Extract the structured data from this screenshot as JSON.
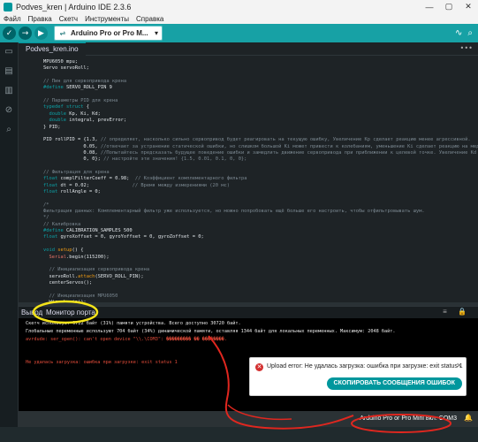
{
  "window": {
    "title": "Podves_kren | Arduino IDE 2.3.6",
    "controls": [
      "—",
      "▢",
      "✕"
    ]
  },
  "menu": [
    "Файл",
    "Правка",
    "Скетч",
    "Инструменты",
    "Справка"
  ],
  "toolbar": {
    "board": "Arduino Pro or Pro M..."
  },
  "tab": {
    "name": "Podves_kren.ino",
    "more": "•••"
  },
  "code": [
    {
      "n": "",
      "t": [
        [
          "MPU6050 mpu;",
          ""
        ]
      ]
    },
    {
      "n": "",
      "t": [
        [
          "Servo servoRoll;",
          ""
        ]
      ]
    },
    {
      "n": "",
      "t": [
        [
          "",
          ""
        ]
      ]
    },
    {
      "n": "",
      "t": [
        [
          "// Пин для сервопривода крена",
          "c"
        ]
      ]
    },
    {
      "n": "",
      "t": [
        [
          "#define ",
          "k"
        ],
        [
          "SERVO_ROLL_PIN 9",
          ""
        ]
      ]
    },
    {
      "n": "",
      "t": [
        [
          "",
          ""
        ]
      ]
    },
    {
      "n": "",
      "t": [
        [
          "// Параметры PID для крена",
          "c"
        ]
      ]
    },
    {
      "n": "",
      "t": [
        [
          "typedef struct ",
          "k"
        ],
        [
          "{",
          ""
        ]
      ]
    },
    {
      "n": "",
      "t": [
        [
          "  double ",
          "k"
        ],
        [
          "Kp, Ki, Kd;",
          ""
        ]
      ]
    },
    {
      "n": "",
      "t": [
        [
          "  double ",
          "k"
        ],
        [
          "integral, prevError;",
          ""
        ]
      ]
    },
    {
      "n": "",
      "t": [
        [
          "} PID;",
          ""
        ]
      ]
    },
    {
      "n": "",
      "t": [
        [
          "",
          ""
        ]
      ]
    },
    {
      "n": "",
      "t": [
        [
          "PID rollPID = {1.3, ",
          ""
        ],
        [
          "// определяет, насколько сильно сервопривод будет реагировать на текущую ошибку, Увеличение Kp сделает реакцию менее агрессивной.",
          "c"
        ]
      ]
    },
    {
      "n": "",
      "t": [
        [
          "              0.05, ",
          ""
        ],
        [
          "//отвечает за устранение статической ошибки, но слишком большой Ki может привести к колебаниям, уменьшение Ki сделает реакцию на медленные измене",
          "c"
        ]
      ]
    },
    {
      "n": "",
      "t": [
        [
          "              0.08, ",
          ""
        ],
        [
          "//Попытайтесь предсказать будущее поведение ошибки и замедлить движение сервопривода при приближении к целевой точке. Увеличение Kd поможет сгладить",
          "c"
        ]
      ]
    },
    {
      "n": "",
      "t": [
        [
          "              0, 0}; ",
          ""
        ],
        [
          "// настройте эти значения! {1.5, 0.01, 0.1, 0, 0};",
          "c"
        ]
      ]
    },
    {
      "n": "",
      "t": [
        [
          "",
          ""
        ]
      ]
    },
    {
      "n": "",
      "t": [
        [
          "// Фильтрация для крена",
          "c"
        ]
      ]
    },
    {
      "n": "",
      "t": [
        [
          "float ",
          "k"
        ],
        [
          "complFilterCoeff = 0.98;  ",
          ""
        ],
        [
          "// Коэффициент комплементарного фильтра",
          "c"
        ]
      ]
    },
    {
      "n": "",
      "t": [
        [
          "float ",
          "k"
        ],
        [
          "dt = 0.02;               ",
          ""
        ],
        [
          "// Время между измерениями (20 мс)",
          "c"
        ]
      ]
    },
    {
      "n": "",
      "t": [
        [
          "float ",
          "k"
        ],
        [
          "rollAngle = 0;",
          ""
        ]
      ]
    },
    {
      "n": "",
      "t": [
        [
          "",
          ""
        ]
      ]
    },
    {
      "n": "",
      "t": [
        [
          "/*",
          "c"
        ]
      ]
    },
    {
      "n": "",
      "t": [
        [
          "Фильтрация данных: Комплементарный фильтр уже используется, но можно попробовать ещё больше его настроить, чтобы отфильтровывать шум.",
          "c"
        ]
      ]
    },
    {
      "n": "",
      "t": [
        [
          "*/",
          "c"
        ]
      ]
    },
    {
      "n": "",
      "t": [
        [
          "// Калибровка",
          "c"
        ]
      ]
    },
    {
      "n": "",
      "t": [
        [
          "#define ",
          "k"
        ],
        [
          "CALIBRATION_SAMPLES 500",
          ""
        ]
      ]
    },
    {
      "n": "",
      "t": [
        [
          "float ",
          "k"
        ],
        [
          "gyroXoffset = 0, gyroYoffset = 0, gyroZoffset = 0;",
          ""
        ]
      ]
    },
    {
      "n": "",
      "t": [
        [
          "",
          ""
        ]
      ]
    },
    {
      "n": "",
      "t": [
        [
          "void ",
          "k"
        ],
        [
          "setup",
          "f"
        ],
        [
          "() {",
          ""
        ]
      ]
    },
    {
      "n": "",
      "t": [
        [
          "  Serial",
          "t"
        ],
        [
          ".begin(115200);",
          ""
        ]
      ]
    },
    {
      "n": "",
      "t": [
        [
          "",
          ""
        ]
      ]
    },
    {
      "n": "",
      "t": [
        [
          "  // Инициализация сервопривода крена",
          "c"
        ]
      ]
    },
    {
      "n": "",
      "t": [
        [
          "  servoRoll.",
          ""
        ],
        [
          "attach",
          "f"
        ],
        [
          "(SERVO_ROLL_PIN);",
          ""
        ]
      ]
    },
    {
      "n": "",
      "t": [
        [
          "  centerServos();",
          ""
        ]
      ]
    },
    {
      "n": "",
      "t": [
        [
          "",
          ""
        ]
      ]
    },
    {
      "n": "",
      "t": [
        [
          "  // Инициализация MPU6050",
          "c"
        ]
      ]
    },
    {
      "n": "",
      "t": [
        [
          "  Wire.begin();",
          ""
        ]
      ]
    }
  ],
  "output_panel": {
    "tab_output": "Вывод",
    "tab_monitor": "Монитор порта",
    "icons": "≡ 🔒"
  },
  "output_lines": [
    {
      "text": "Скетч использует 9722 байт (31%) памяти устройства. Всего доступно 30720 байт.",
      "cls": ""
    },
    {
      "text": "Глобальные переменные используют 704 байт (34%) динамической памяти, оставляя 1344 байт для локальных переменных. Максимум: 2048 байт.",
      "cls": ""
    },
    {
      "text": "avrdude: ser_open(): can't open device \"\\\\.\\COM3\": ��������� �� ��������.",
      "cls": "err"
    },
    {
      "text": "",
      "cls": ""
    },
    {
      "text": "",
      "cls": ""
    },
    {
      "text": "Не удалась загрузка: ошибка при загрузке: exit status 1",
      "cls": "err"
    }
  ],
  "toast": {
    "message": "Upload error: Не удалась загрузка: ошибка при загрузке: exit status 1",
    "button": "СКОПИРОВАТЬ СООБЩЕНИЯ ОШИБОК"
  },
  "statusbar": {
    "board": "Arduino Pro or Pro Mini вкл. COM3"
  },
  "annotation_color": "#e0271f",
  "highlight_color": "#f2e21a"
}
